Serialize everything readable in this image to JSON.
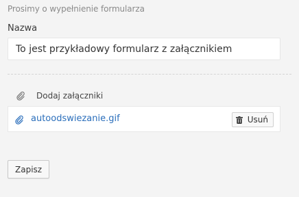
{
  "form": {
    "instruction": "Prosimy o wypełnienie formularza",
    "name_label": "Nazwa",
    "name_value": "To jest przykładowy formularz z załącznikiem"
  },
  "attachments": {
    "header_icon": "paperclip-icon",
    "add_label": "Dodaj załączniki",
    "files": [
      {
        "icon": "paperclip-icon",
        "name": "autoodswiezanie.gif",
        "remove_icon": "trash-icon",
        "remove_label": "Usuń"
      }
    ]
  },
  "actions": {
    "save_label": "Zapisz"
  },
  "colors": {
    "page_background": "#f4f4f4",
    "link": "#2a6ebb",
    "muted_text": "#8a8a8a"
  }
}
